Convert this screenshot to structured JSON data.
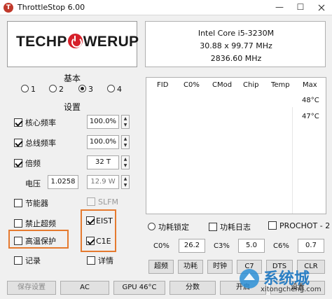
{
  "window": {
    "title": "ThrottleStop 6.00",
    "icon": "T",
    "minimize": "—",
    "maximize": "☐"
  },
  "logo": {
    "part1": "TECHP",
    "part2": "WERUP"
  },
  "cpu": {
    "name": "Intel Core i5-3230M",
    "bus": "30.88 x 99.77 MHz",
    "freq": "2836.60 MHz"
  },
  "profiles": {
    "title": "基本",
    "options": [
      "1",
      "2",
      "3",
      "4"
    ],
    "selected": "3"
  },
  "settings": {
    "title": "设置",
    "core_ratio": {
      "label": "核心频率",
      "value": "100.0%",
      "checked": true
    },
    "bus_ratio": {
      "label": "总线频率",
      "value": "100.0%",
      "checked": true
    },
    "multiplier": {
      "label": "倍频",
      "value": "32 T",
      "checked": true
    },
    "voltage": {
      "label": "电压",
      "value1": "1.0258",
      "value2": "12.9 W"
    },
    "power_saver": {
      "label": "节能器",
      "checked": false
    },
    "slfm": {
      "label": "SLFM",
      "checked": false
    },
    "disable_turbo": {
      "label": "禁止超频",
      "checked": false
    },
    "eist": {
      "label": "EIST",
      "checked": true
    },
    "bd_prochot": {
      "label": "高温保护",
      "checked": false
    },
    "c1e": {
      "label": "C1E",
      "checked": true
    },
    "log": {
      "label": "记录",
      "checked": false
    },
    "more_data": {
      "label": "详情",
      "checked": false
    }
  },
  "table": {
    "headers": [
      "FID",
      "C0%",
      "CMod",
      "Chip",
      "Temp",
      "Max"
    ],
    "max_values": [
      "48°C",
      "47°C"
    ]
  },
  "monitor": {
    "turbo_lock": "功耗锁定",
    "power_log": "功耗日志",
    "prochot": "PROCHOT - 2"
  },
  "states": [
    {
      "label": "C0%",
      "value": "26.2"
    },
    {
      "label": "C3%",
      "value": "5.0"
    },
    {
      "label": "C6%",
      "value": "0.7"
    }
  ],
  "right_buttons": [
    "超频",
    "功耗",
    "时钟",
    "C7",
    "DTS",
    "CLR"
  ],
  "bottom_buttons": [
    "保存设置",
    "AC",
    "GPU 46°C",
    "分数",
    "开启",
    "设置"
  ],
  "watermark": {
    "text": "系统城",
    "url": "xitongcheng.com"
  }
}
